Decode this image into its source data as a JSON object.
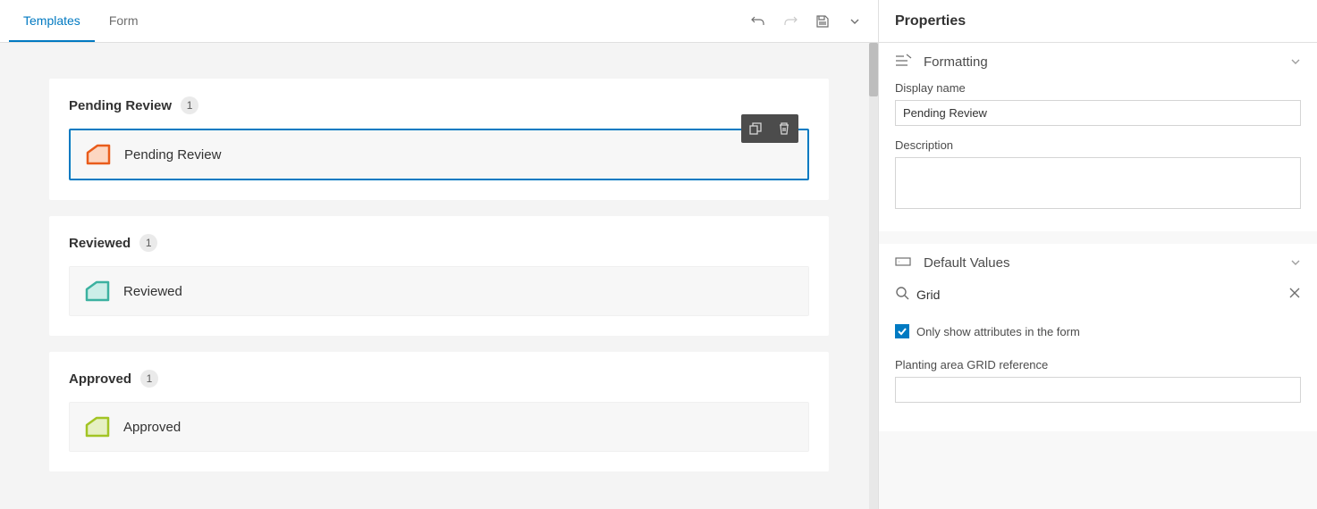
{
  "tabs": {
    "templates": "Templates",
    "form": "Form",
    "active": "templates"
  },
  "groups": [
    {
      "title": "Pending Review",
      "count": "1",
      "items": [
        {
          "label": "Pending Review",
          "selected": true,
          "color": "orange"
        }
      ]
    },
    {
      "title": "Reviewed",
      "count": "1",
      "items": [
        {
          "label": "Reviewed",
          "selected": false,
          "color": "teal"
        }
      ]
    },
    {
      "title": "Approved",
      "count": "1",
      "items": [
        {
          "label": "Approved",
          "selected": false,
          "color": "green"
        }
      ]
    }
  ],
  "properties": {
    "title": "Properties",
    "formatting": {
      "header": "Formatting",
      "display_name_label": "Display name",
      "display_name_value": "Pending Review",
      "description_label": "Description",
      "description_value": ""
    },
    "default_values": {
      "header": "Default Values",
      "search_value": "Grid",
      "only_show_checked": true,
      "only_show_label": "Only show attributes in the form",
      "field_label": "Planting area GRID reference",
      "field_value": ""
    }
  },
  "colors": {
    "orange": {
      "stroke": "#e95c1b",
      "fill": "#fcd7c2"
    },
    "teal": {
      "stroke": "#3bb1a0",
      "fill": "#cceee8"
    },
    "green": {
      "stroke": "#a2c424",
      "fill": "#e6f0c3"
    }
  }
}
